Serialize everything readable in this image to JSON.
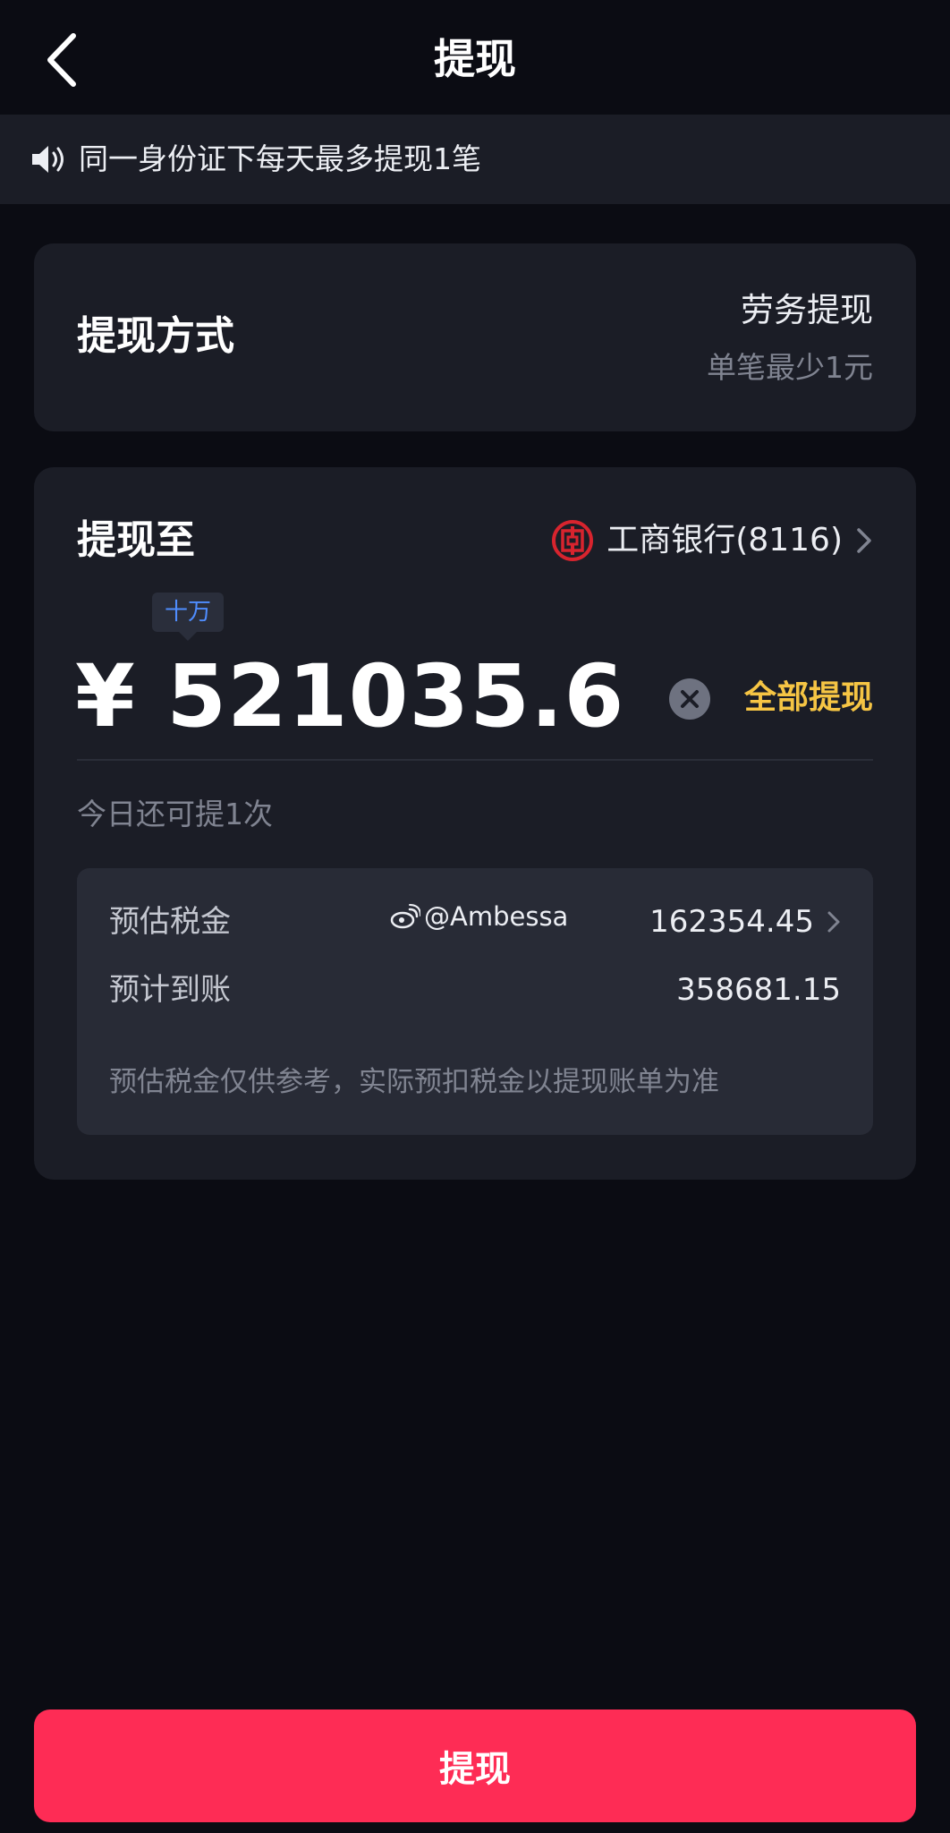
{
  "header": {
    "title": "提现",
    "back_icon": "chevron-left-icon"
  },
  "notice": {
    "icon": "speaker-icon",
    "text": "同一身份证下每天最多提现1笔"
  },
  "method_card": {
    "label": "提现方式",
    "value": "劳务提现",
    "sub": "单笔最少1元"
  },
  "withdraw_card": {
    "label": "提现至",
    "bank": {
      "logo_icon": "icbc-logo-icon",
      "name": "工商银行(8116)",
      "chevron_icon": "chevron-right-icon"
    },
    "unit_tag": "十万",
    "amount": "¥ 521035.6",
    "clear_icon": "close-circle-icon",
    "withdraw_all": "全部提现",
    "remaining": "今日还可提1次",
    "tax": {
      "estimated_tax_label": "预估税金",
      "estimated_tax_value": "162354.45",
      "expected_arrival_label": "预计到账",
      "expected_arrival_value": "358681.15",
      "note": "预估税金仅供参考，实际预扣税金以提现账单为准"
    }
  },
  "watermark": {
    "icon": "weibo-icon",
    "text": "@Ambessa"
  },
  "submit": {
    "label": "提现"
  },
  "colors": {
    "background": "#0b0c13",
    "card": "#1b1d26",
    "accent_red": "#fe2c55",
    "accent_yellow": "#f6c544",
    "tag_blue": "#4f8dff",
    "bank_red": "#d8242e"
  }
}
